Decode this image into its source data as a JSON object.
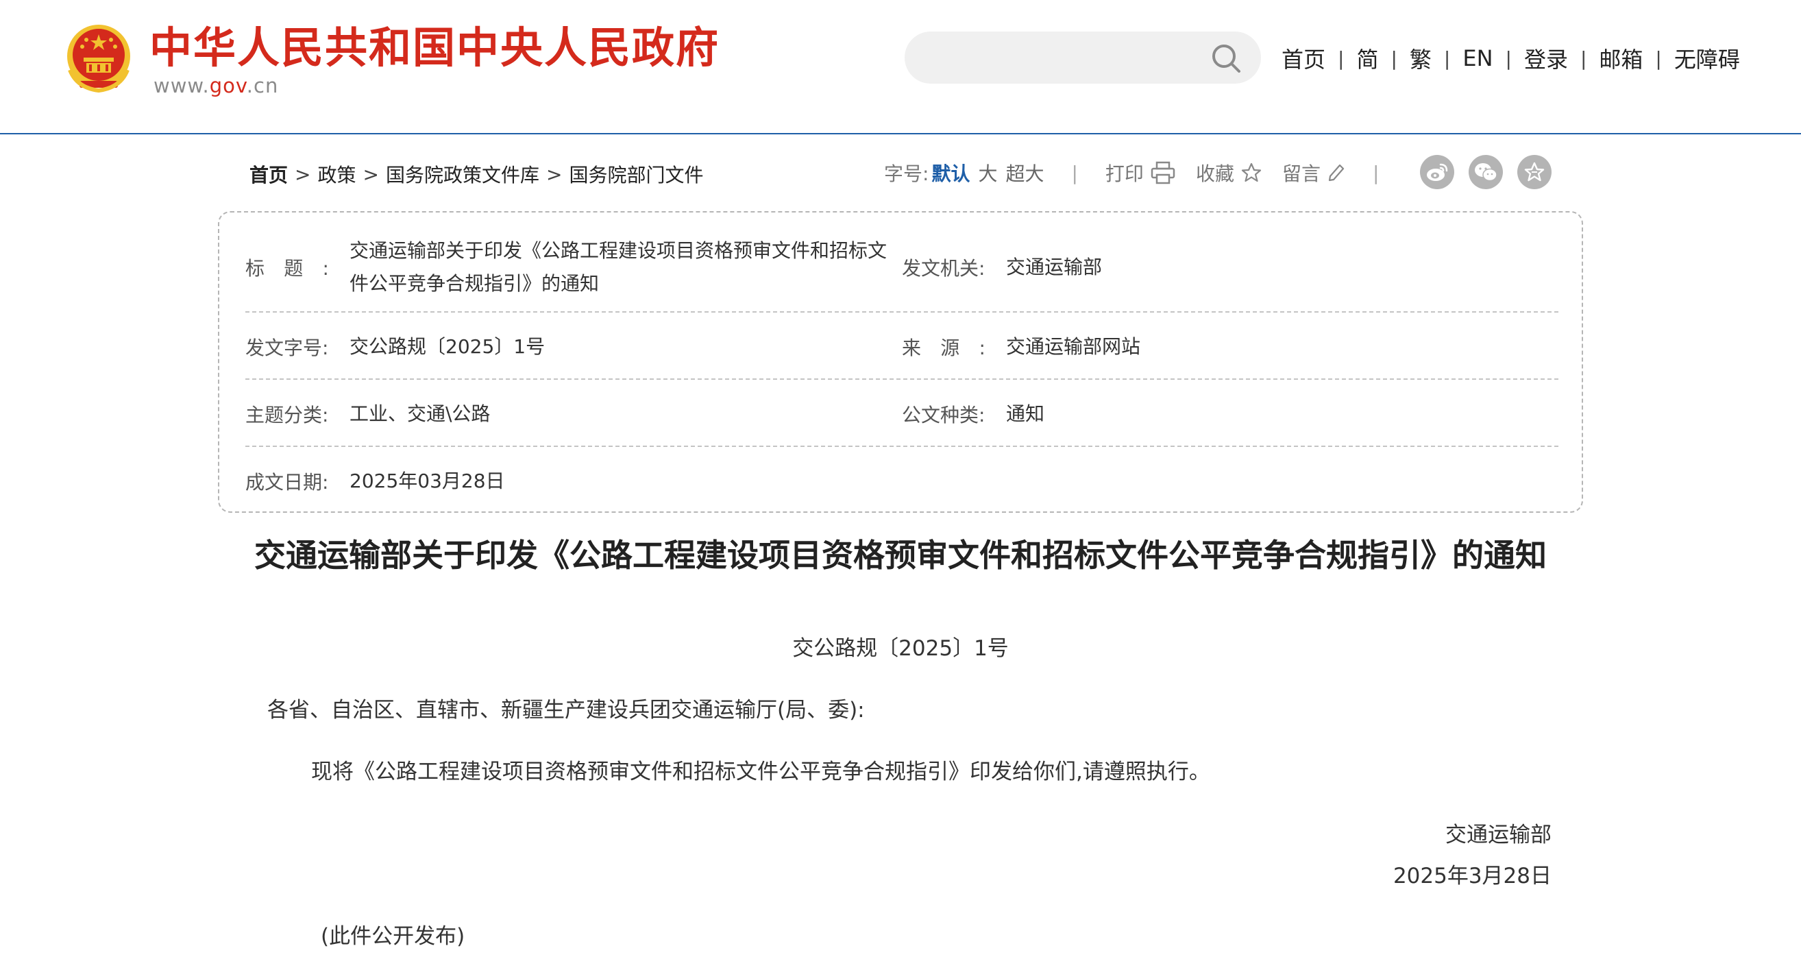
{
  "header": {
    "site_name": "中华人民共和国中央人民政府",
    "site_url_prefix": "www.",
    "site_url_gov": "gov",
    "site_url_suffix": ".cn",
    "search": {
      "value": "",
      "placeholder": ""
    },
    "nav": [
      {
        "label": "首页"
      },
      {
        "label": "简"
      },
      {
        "label": "繁"
      },
      {
        "label": "EN"
      },
      {
        "label": "登录"
      },
      {
        "label": "邮箱"
      },
      {
        "label": "无障碍"
      }
    ],
    "nav_separator": "|"
  },
  "breadcrumb": {
    "items": [
      "首页",
      "政策",
      "国务院政策文件库",
      "国务院部门文件"
    ],
    "separator": ">"
  },
  "toolbar": {
    "font_size_label": "字号:",
    "font_default": "默认",
    "font_large": "大",
    "font_xlarge": "超大",
    "divider": "|",
    "print_label": "打印",
    "favorite_label": "收藏",
    "comment_label": "留言",
    "share_icons": [
      "weibo-icon",
      "wechat-icon",
      "favorite-star-icon"
    ]
  },
  "info": {
    "title_label": "标",
    "title_label_2": "题:",
    "title_value": "交通运输部关于印发《公路工程建设项目资格预审文件和招标文件公平竞争合规指引》的通知",
    "issuer_label": "发文机关:",
    "issuer_value": "交通运输部",
    "doc_no_label": "发文字号:",
    "doc_no_value": "交公路规〔2025〕1号",
    "source_label": "来",
    "source_label_2": "源:",
    "source_value": "交通运输部网站",
    "topic_label": "主题分类:",
    "topic_value": "工业、交通\\公路",
    "type_label": "公文种类:",
    "type_value": "通知",
    "date_label": "成文日期:",
    "date_value": "2025年03月28日"
  },
  "article": {
    "title": "交通运输部关于印发《公路工程建设项目资格预审文件和招标文件公平竞争合规指引》的通知",
    "doc_number": "交公路规〔2025〕1号",
    "addressee": "各省、自治区、直辖市、新疆生产建设兵团交通运输厅(局、委):",
    "body": "现将《公路工程建设项目资格预审文件和招标文件公平竞争合规指引》印发给你们,请遵照执行。",
    "signature_org": "交通运输部",
    "signature_date": "2025年3月28日",
    "public_note": "(此件公开发布)"
  },
  "colors": {
    "brand_red": "#d42a1c",
    "link_blue": "#1f5fa8",
    "emblem_gold": "#f2c230"
  }
}
